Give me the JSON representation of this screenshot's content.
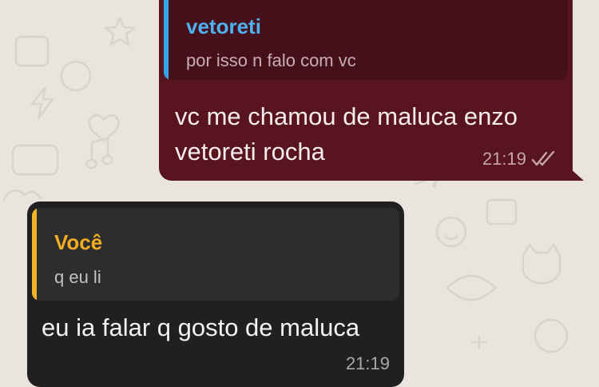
{
  "conversation": {
    "outgoing": {
      "reply_to": {
        "author": "vetoreti",
        "text": "por isso n falo com vc"
      },
      "text": "vc me chamou de maluca enzo vetoreti rocha",
      "time": "21:19",
      "status_icon": "double-check-icon"
    },
    "incoming": {
      "reply_to": {
        "author": "Você",
        "text": "q eu li"
      },
      "text": "eu ia falar q gosto de maluca",
      "time": "21:19"
    }
  },
  "colors": {
    "wallpaper": "#e9e4dd",
    "outgoing_bubble": "#58141f",
    "incoming_bubble": "#202020",
    "quote_bar_outgoing": "#35a3e8",
    "quote_bar_incoming": "#f0b429"
  }
}
